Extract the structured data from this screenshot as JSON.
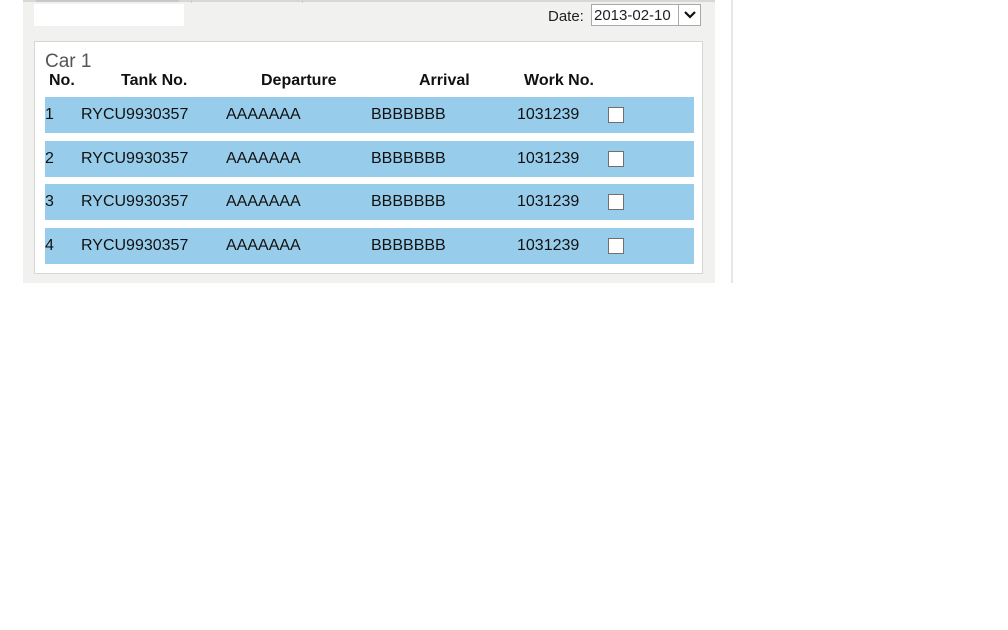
{
  "date_filter": {
    "label": "Date:",
    "selected_value": "2013-02-10"
  },
  "car": {
    "title": "Car 1",
    "columns": [
      "No.",
      "Tank No.",
      "Departure",
      "Arrival",
      "Work No."
    ],
    "rows": [
      {
        "no": "1",
        "tank_no": "RYCU9930357",
        "departure": "AAAAAAA",
        "arrival": "BBBBBBB",
        "work_no": "1031239",
        "checked": false
      },
      {
        "no": "2",
        "tank_no": "RYCU9930357",
        "departure": "AAAAAAA",
        "arrival": "BBBBBBB",
        "work_no": "1031239",
        "checked": false
      },
      {
        "no": "3",
        "tank_no": "RYCU9930357",
        "departure": "AAAAAAA",
        "arrival": "BBBBBBB",
        "work_no": "1031239",
        "checked": false
      },
      {
        "no": "4",
        "tank_no": "RYCU9930357",
        "departure": "AAAAAAA",
        "arrival": "BBBBBBB",
        "work_no": "1031239",
        "checked": false
      }
    ]
  },
  "colors": {
    "row_background": "#97cdeb",
    "panel_background": "#f1f1ef"
  }
}
